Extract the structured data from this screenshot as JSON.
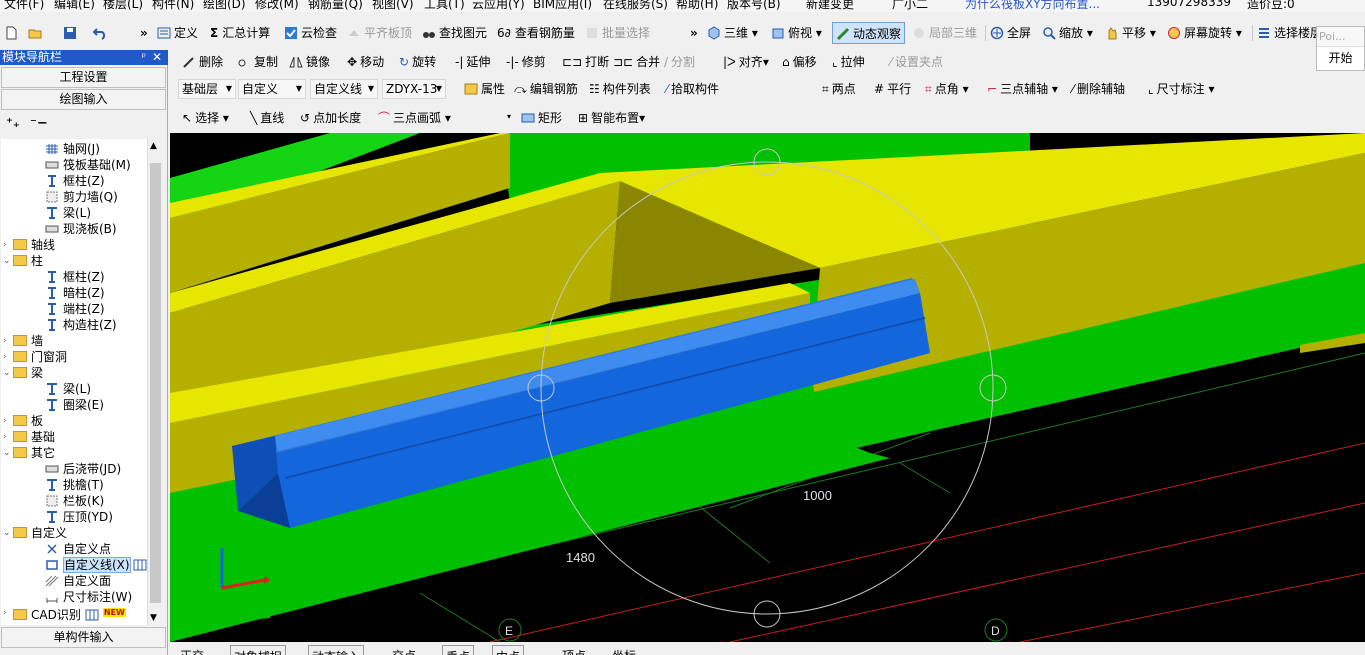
{
  "menu": [
    "文件(F)",
    "编辑(E)",
    "楼层(L)",
    "构件(N)",
    "绘图(D)",
    "修改(M)",
    "钢筋量(Q)",
    "视图(V)",
    "工具(T)",
    "云应用(Y)",
    "BIM应用(I)",
    "在线服务(S)",
    "帮助(H)",
    "版本号(B)",
    "新建变更",
    "广小二",
    "为什么筏板XY方向布置...",
    "13907298339",
    "造价豆:0"
  ],
  "toolbar1": {
    "define": "定义",
    "sum": "汇总计算",
    "cloud_check": "云检查",
    "flat_top": "平齐板顶",
    "find_elem": "查找图元",
    "view_rebar": "查看钢筋量",
    "batch_select": "批量选择",
    "three_d": "三维",
    "top_view": "俯视",
    "dynamic_view": "动态观察",
    "local_3d": "局部三维",
    "fullscreen": "全屏",
    "zoom": "缩放",
    "pan": "平移",
    "rotate_screen": "屏幕旋转",
    "select_floor": "选择楼层"
  },
  "popup": {
    "title": "Poi...",
    "button": "开始"
  },
  "toolbar2": {
    "delete": "删除",
    "copy": "复制",
    "mirror": "镜像",
    "move": "移动",
    "rotate": "旋转",
    "extend": "延伸",
    "trim": "修剪",
    "break": "打断",
    "merge": "合并",
    "split": "分割",
    "align": "对齐",
    "offset": "偏移",
    "stretch": "拉伸",
    "set_point": "设置夹点"
  },
  "toolbar3": {
    "floor": "基础层",
    "category": "自定义",
    "type": "自定义线",
    "name": "ZDYX-13",
    "attr": "属性",
    "edit_rebar": "编辑钢筋",
    "comp_list": "构件列表",
    "pick": "拾取构件",
    "two_point": "两点",
    "parallel": "平行",
    "point_angle": "点角",
    "three_point_aux": "三点辅轴",
    "delete_aux": "删除辅轴",
    "dim": "尺寸标注"
  },
  "toolbar4": {
    "select": "选择",
    "line": "直线",
    "point_len": "点加长度",
    "arc": "三点画弧",
    "rect": "矩形",
    "smart": "智能布置"
  },
  "nav": {
    "title": "模块导航栏",
    "btn_project": "工程设置",
    "btn_draw": "绘图输入",
    "btn_single": "单构件输入",
    "tree": [
      {
        "label": "轴网(J)",
        "level": 2,
        "icon": "grid"
      },
      {
        "label": "筏板基础(M)",
        "level": 2,
        "icon": "slab"
      },
      {
        "label": "框柱(Z)",
        "level": 2,
        "icon": "column"
      },
      {
        "label": "剪力墙(Q)",
        "level": 2,
        "icon": "wall"
      },
      {
        "label": "梁(L)",
        "level": 2,
        "icon": "beam"
      },
      {
        "label": "现浇板(B)",
        "level": 2,
        "icon": "slab"
      },
      {
        "label": "轴线",
        "level": 1,
        "icon": "folder",
        "state": "closed"
      },
      {
        "label": "柱",
        "level": 1,
        "icon": "folder",
        "state": "open"
      },
      {
        "label": "框柱(Z)",
        "level": 2,
        "icon": "column"
      },
      {
        "label": "暗柱(Z)",
        "level": 2,
        "icon": "column"
      },
      {
        "label": "端柱(Z)",
        "level": 2,
        "icon": "column"
      },
      {
        "label": "构造柱(Z)",
        "level": 2,
        "icon": "column"
      },
      {
        "label": "墙",
        "level": 1,
        "icon": "folder",
        "state": "closed"
      },
      {
        "label": "门窗洞",
        "level": 1,
        "icon": "folder",
        "state": "closed"
      },
      {
        "label": "梁",
        "level": 1,
        "icon": "folder",
        "state": "open"
      },
      {
        "label": "梁(L)",
        "level": 2,
        "icon": "beam"
      },
      {
        "label": "圈梁(E)",
        "level": 2,
        "icon": "beam"
      },
      {
        "label": "板",
        "level": 1,
        "icon": "folder",
        "state": "closed"
      },
      {
        "label": "基础",
        "level": 1,
        "icon": "folder",
        "state": "closed"
      },
      {
        "label": "其它",
        "level": 1,
        "icon": "folder",
        "state": "open"
      },
      {
        "label": "后浇带(JD)",
        "level": 2,
        "icon": "slab"
      },
      {
        "label": "挑檐(T)",
        "level": 2,
        "icon": "beam"
      },
      {
        "label": "栏板(K)",
        "level": 2,
        "icon": "wall"
      },
      {
        "label": "压顶(YD)",
        "level": 2,
        "icon": "beam"
      },
      {
        "label": "自定义",
        "level": 1,
        "icon": "folder",
        "state": "open"
      },
      {
        "label": "自定义点",
        "level": 2,
        "icon": "point"
      },
      {
        "label": "自定义线(X)",
        "level": 2,
        "icon": "line",
        "selected": true
      },
      {
        "label": "自定义面",
        "level": 2,
        "icon": "face"
      },
      {
        "label": "尺寸标注(W)",
        "level": 2,
        "icon": "dim"
      },
      {
        "label": "CAD识别",
        "level": 1,
        "icon": "folder",
        "state": "closed",
        "badge": "NEW"
      }
    ]
  },
  "viewport": {
    "dim1": "1000",
    "dim2": "1480",
    "axis_e": "E",
    "axis_d": "D"
  },
  "statusbar": [
    "正交",
    "对象捕捉",
    "动态输入",
    "交点",
    "垂点",
    "中点",
    "顶点",
    "坐标"
  ],
  "colors": {
    "nav_title": "#1e5bc6",
    "beam_yellow": "#b5b000",
    "beam_bright": "#e6e600",
    "slab_green": "#00c000",
    "custom_line_blue": "#1466dd",
    "grid_red": "#c81e1e",
    "grid_green": "#1f7a1f"
  }
}
